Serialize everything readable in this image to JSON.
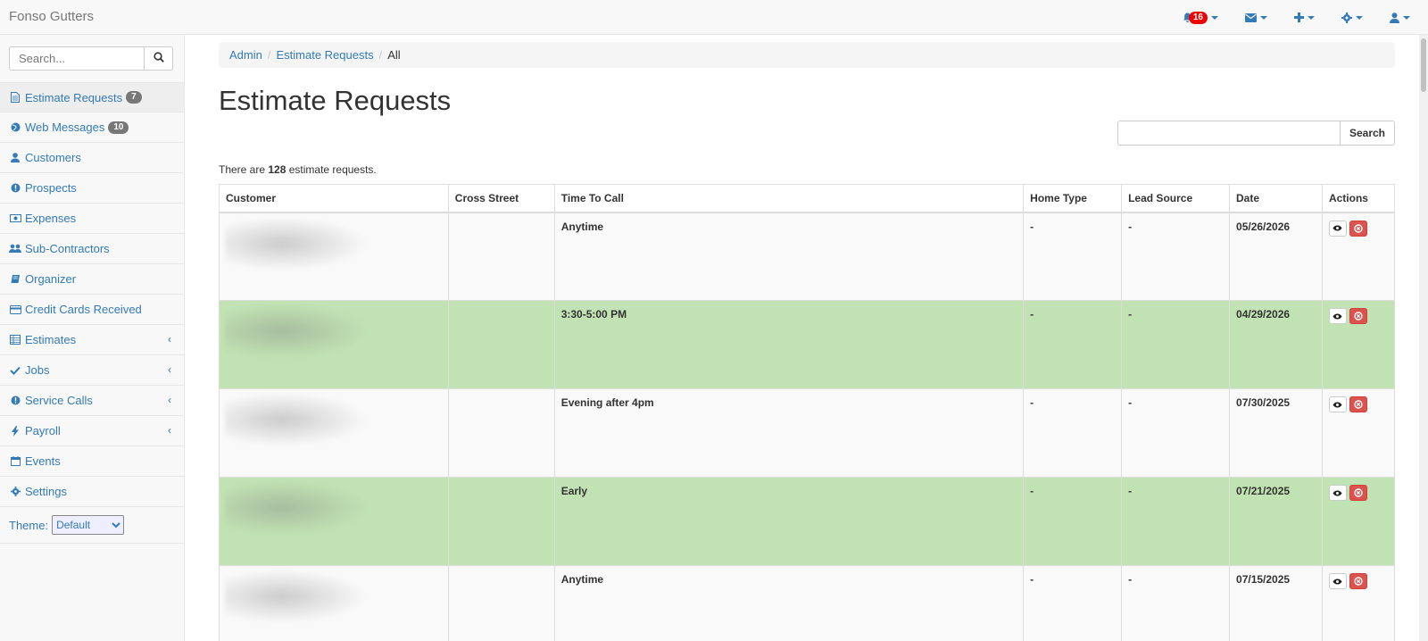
{
  "app": {
    "brand": "Fonso Gutters"
  },
  "navbar": {
    "notifications_count": "16",
    "icons": [
      "bell-icon",
      "envelope-icon",
      "plus-icon",
      "gear-icon",
      "user-icon"
    ]
  },
  "sidebar": {
    "search_placeholder": "Search...",
    "items": [
      {
        "label": "Estimate Requests",
        "icon": "file-icon",
        "badge": "7"
      },
      {
        "label": "Web Messages",
        "icon": "globe-icon",
        "badge": "10"
      },
      {
        "label": "Customers",
        "icon": "user-icon"
      },
      {
        "label": "Prospects",
        "icon": "info-icon"
      },
      {
        "label": "Expenses",
        "icon": "money-icon"
      },
      {
        "label": "Sub-Contractors",
        "icon": "users-icon"
      },
      {
        "label": "Organizer",
        "icon": "book-icon"
      },
      {
        "label": "Credit Cards Received",
        "icon": "credit-card-icon"
      },
      {
        "label": "Estimates",
        "icon": "table-icon"
      },
      {
        "label": "Jobs",
        "icon": "check-icon"
      },
      {
        "label": "Service Calls",
        "icon": "alert-icon"
      },
      {
        "label": "Payroll",
        "icon": "bolt-icon"
      },
      {
        "label": "Events",
        "icon": "calendar-icon"
      },
      {
        "label": "Settings",
        "icon": "gear-icon"
      }
    ],
    "theme_label": "Theme:",
    "theme_value": "Default"
  },
  "breadcrumb": [
    "Admin",
    "Estimate Requests",
    "All"
  ],
  "main": {
    "title": "Estimate Requests",
    "search_button": "Search",
    "count_prefix": "There are ",
    "count": "128",
    "count_suffix": " estimate requests."
  },
  "table": {
    "columns": [
      "Customer",
      "Cross Street",
      "Time To Call",
      "Home Type",
      "Lead Source",
      "Date",
      "Actions"
    ],
    "rows": [
      {
        "time_to_call": "Anytime",
        "home_type": "-",
        "lead_source": "-",
        "date": "05/26/2026",
        "highlight": false
      },
      {
        "time_to_call": "3:30-5:00 PM",
        "home_type": "-",
        "lead_source": "-",
        "date": "04/29/2026",
        "highlight": true
      },
      {
        "time_to_call": "Evening after 4pm",
        "home_type": "-",
        "lead_source": "-",
        "date": "07/30/2025",
        "highlight": false
      },
      {
        "time_to_call": "Early",
        "home_type": "-",
        "lead_source": "-",
        "date": "07/21/2025",
        "highlight": true
      },
      {
        "time_to_call": "Anytime",
        "home_type": "-",
        "lead_source": "-",
        "date": "07/15/2025",
        "highlight": false
      }
    ]
  },
  "colors": {
    "link": "#337ab7",
    "highlight_row": "#c1e2b3",
    "danger": "#d9534f",
    "badge_red": "#ee0000"
  }
}
